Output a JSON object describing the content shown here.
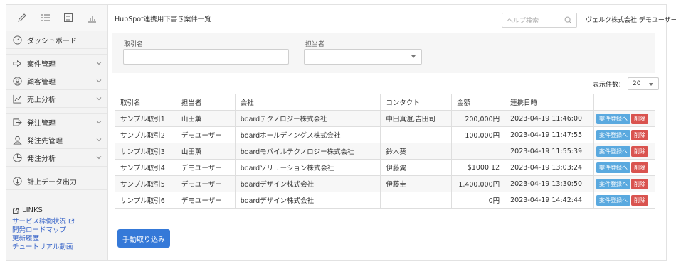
{
  "sidebar": {
    "toolbar_icons": [
      "pencil-icon",
      "list-icon",
      "table-icon",
      "bar-chart-icon"
    ],
    "items": [
      {
        "label": "ダッシュボード",
        "icon": "dashboard-icon",
        "has_chevron": false
      },
      {
        "label": "案件管理",
        "icon": "deal-icon",
        "has_chevron": true
      },
      {
        "label": "顧客管理",
        "icon": "customer-icon",
        "has_chevron": true
      },
      {
        "label": "売上分析",
        "icon": "chart-icon",
        "has_chevron": true
      },
      {
        "label": "発注管理",
        "icon": "order-icon",
        "has_chevron": true
      },
      {
        "label": "発注先管理",
        "icon": "supplier-icon",
        "has_chevron": true
      },
      {
        "label": "発注分析",
        "icon": "pie-icon",
        "has_chevron": true
      },
      {
        "label": "計上データ出力",
        "icon": "export-icon",
        "has_chevron": false
      }
    ],
    "links": {
      "title": "LINKS",
      "items": [
        "サービス稼働状況",
        "開発ロードマップ",
        "更新履歴",
        "チュートリアル動画"
      ]
    }
  },
  "header": {
    "title": "HubSpot連携用下書き案件一覧",
    "help_placeholder": "ヘルプ検索",
    "user": "ヴェルク株式会社 デモユーザー"
  },
  "filter": {
    "deal_label": "取引名",
    "deal_value": "",
    "owner_label": "担当者",
    "owner_value": ""
  },
  "perpage": {
    "label": "表示件数：",
    "value": "20"
  },
  "table": {
    "headers": [
      "取引名",
      "担当者",
      "会社",
      "コンタクト",
      "金額",
      "連携日時",
      ""
    ],
    "rows": [
      {
        "deal": "サンプル取引1",
        "owner": "山田薫",
        "company": "boardテクノロジー株式会社",
        "contact": "中田真澄,吉田司",
        "amount": "200,000円",
        "datetime": "2023-04-19 11:46:00"
      },
      {
        "deal": "サンプル取引2",
        "owner": "デモユーザー",
        "company": "boardホールディングス株式会社",
        "contact": "",
        "amount": "100,000円",
        "datetime": "2023-04-19 11:47:55"
      },
      {
        "deal": "サンプル取引3",
        "owner": "山田薫",
        "company": "boardモバイルテクノロジー株式会社",
        "contact": "鈴木葵",
        "amount": "",
        "datetime": "2023-04-19 11:55:39"
      },
      {
        "deal": "サンプル取引4",
        "owner": "デモユーザー",
        "company": "boardソリューション株式会社",
        "contact": "伊藤翼",
        "amount": "$1000.12",
        "datetime": "2023-04-19 13:03:24"
      },
      {
        "deal": "サンプル取引5",
        "owner": "デモユーザー",
        "company": "boardデザイン株式会社",
        "contact": "伊藤圭",
        "amount": "1,400,000円",
        "datetime": "2023-04-19 13:30:50"
      },
      {
        "deal": "サンプル取引6",
        "owner": "デモユーザー",
        "company": "boardデザイン株式会社",
        "contact": "",
        "amount": "0円",
        "datetime": "2023-04-19 14:42:44"
      }
    ],
    "register_label": "案件登録へ",
    "delete_label": "削除"
  },
  "import_button": "手動取り込み",
  "colors": {
    "accent": "#3579d8",
    "register": "#5aa9df",
    "delete": "#d9534f",
    "link": "#3a66c9"
  }
}
